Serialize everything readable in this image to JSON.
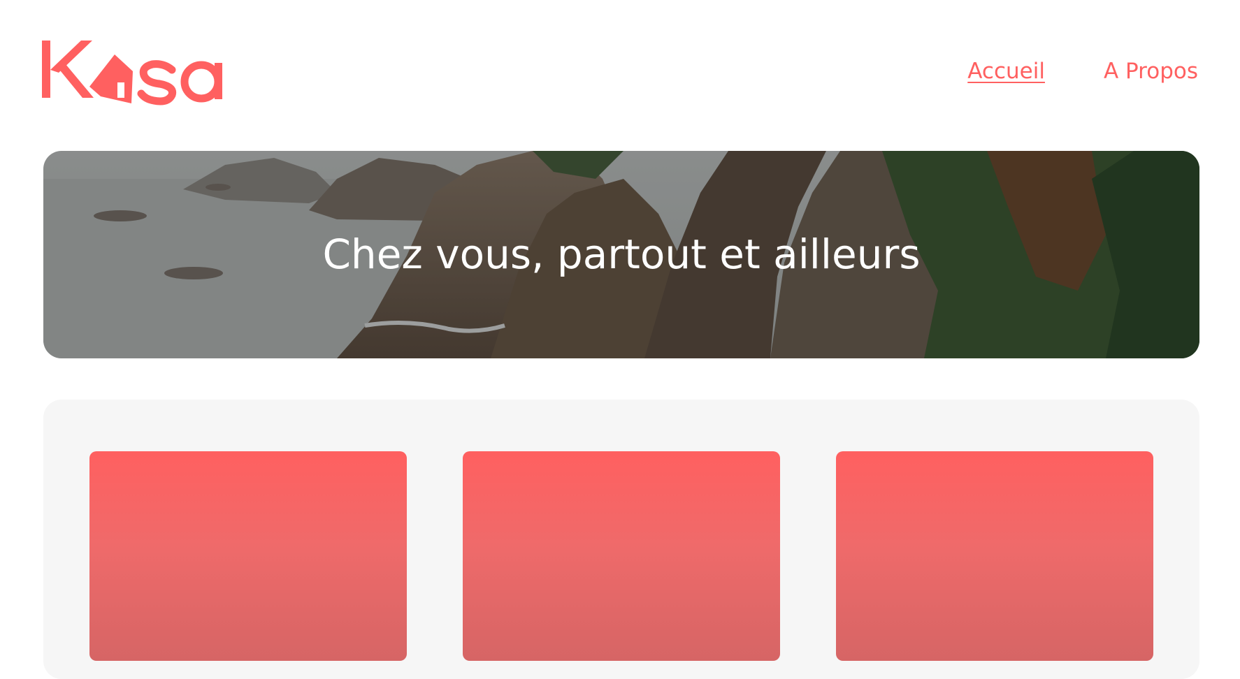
{
  "brand": {
    "logo_text": "Kasa",
    "accent_color": "#FF6060",
    "logo_icon": "house-icon"
  },
  "nav": {
    "items": [
      {
        "label": "Accueil",
        "active": true
      },
      {
        "label": "A Propos",
        "active": false
      }
    ]
  },
  "banner": {
    "title": "Chez vous, partout et ailleurs"
  },
  "gallery": {
    "cards": [
      {
        "title": ""
      },
      {
        "title": ""
      },
      {
        "title": ""
      }
    ]
  }
}
